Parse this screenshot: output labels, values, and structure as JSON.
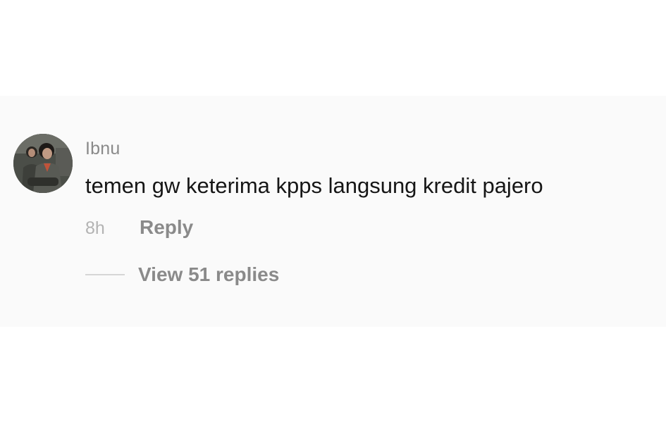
{
  "comment": {
    "username": "Ibnu",
    "text": "temen gw keterima kpps langsung kredit pajero",
    "timestamp": "8h",
    "reply_label": "Reply",
    "view_replies_label": "View 51 replies"
  },
  "avatar": {
    "icon": "user-avatar-photo"
  },
  "colors": {
    "background": "#ffffff",
    "comment_background": "#fafafa",
    "username": "#8a8a8a",
    "text": "#161616",
    "timestamp": "#b3b3b3",
    "action": "#8a8a8a"
  }
}
